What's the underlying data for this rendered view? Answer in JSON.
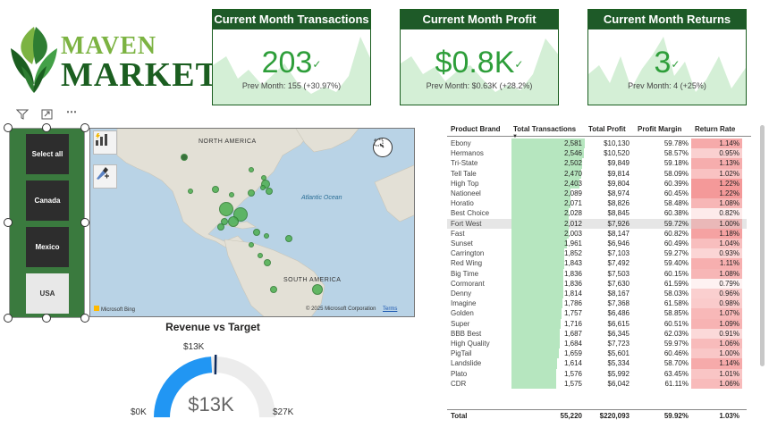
{
  "brand": {
    "word1": "MAVEN",
    "word2": "MARKET"
  },
  "kpis": [
    {
      "title": "Current Month Transactions",
      "value": "203",
      "prev": "Prev Month: 155 (+30.97%)"
    },
    {
      "title": "Current Month Profit",
      "value": "$0.8K",
      "prev": "Prev Month: $0.63K (+28.2%)"
    },
    {
      "title": "Current Month Returns",
      "value": "3",
      "prev": "Prev Month: 4 (+25%)"
    }
  ],
  "slicer": {
    "options": [
      {
        "label": "Select all",
        "selected": true
      },
      {
        "label": "Canada",
        "selected": true
      },
      {
        "label": "Mexico",
        "selected": true
      },
      {
        "label": "USA",
        "selected": false
      }
    ],
    "icons": [
      "filter-icon",
      "focus-mode-icon",
      "more-options-icon"
    ]
  },
  "map": {
    "labels": {
      "north_america": "NORTH AMERICA",
      "south_america": "SOUTH AMERICA",
      "ocean": "Atlantic Ocean"
    },
    "credit_left": "Microsoft Bing",
    "credit_right": "© 2025 Microsoft Corporation",
    "terms": "Terms",
    "bubble_color": "#4caf50"
  },
  "gauge": {
    "title": "Revenue vs Target",
    "min_label": "$0K",
    "max_label": "$27K",
    "target_label": "$13K",
    "value_label": "$13K",
    "value": 13,
    "min": 0,
    "max": 27,
    "fill_color": "#2196f3",
    "target_color": "#0d2a5c"
  },
  "table": {
    "headers": [
      "Product Brand",
      "Total Transactions",
      "Total Profit",
      "Profit Margin",
      "Return Rate"
    ],
    "max_tx": 2581,
    "rows": [
      [
        "Ebony",
        "2,581",
        "$10,130",
        "59.78%",
        "1.14%"
      ],
      [
        "Hermanos",
        "2,546",
        "$10,520",
        "58.57%",
        "0.95%"
      ],
      [
        "Tri-State",
        "2,502",
        "$9,849",
        "59.18%",
        "1.13%"
      ],
      [
        "Tell Tale",
        "2,470",
        "$9,814",
        "58.09%",
        "1.02%"
      ],
      [
        "High Top",
        "2,403",
        "$9,804",
        "60.39%",
        "1.22%"
      ],
      [
        "Nationeel",
        "2,089",
        "$8,974",
        "60.45%",
        "1.22%"
      ],
      [
        "Horatio",
        "2,071",
        "$8,826",
        "58.48%",
        "1.08%"
      ],
      [
        "Best Choice",
        "2,028",
        "$8,845",
        "60.38%",
        "0.82%"
      ],
      [
        "Fort West",
        "2,012",
        "$7,926",
        "59.72%",
        "1.00%"
      ],
      [
        "Fast",
        "2,003",
        "$8,147",
        "60.82%",
        "1.18%"
      ],
      [
        "Sunset",
        "1,961",
        "$6,946",
        "60.49%",
        "1.04%"
      ],
      [
        "Carrington",
        "1,852",
        "$7,103",
        "59.27%",
        "0.93%"
      ],
      [
        "Red Wing",
        "1,843",
        "$7,492",
        "59.40%",
        "1.11%"
      ],
      [
        "Big Time",
        "1,836",
        "$7,503",
        "60.15%",
        "1.08%"
      ],
      [
        "Cormorant",
        "1,836",
        "$7,630",
        "61.59%",
        "0.79%"
      ],
      [
        "Denny",
        "1,814",
        "$8,167",
        "58.03%",
        "0.96%"
      ],
      [
        "Imagine",
        "1,786",
        "$7,368",
        "61.58%",
        "0.98%"
      ],
      [
        "Golden",
        "1,757",
        "$6,486",
        "58.85%",
        "1.07%"
      ],
      [
        "Super",
        "1,716",
        "$6,615",
        "60.51%",
        "1.09%"
      ],
      [
        "BBB Best",
        "1,687",
        "$6,345",
        "62.03%",
        "0.91%"
      ],
      [
        "High Quality",
        "1,684",
        "$7,723",
        "59.97%",
        "1.06%"
      ],
      [
        "PigTail",
        "1,659",
        "$5,601",
        "60.46%",
        "1.00%"
      ],
      [
        "Landslide",
        "1,614",
        "$5,334",
        "58.70%",
        "1.14%"
      ],
      [
        "Plato",
        "1,576",
        "$5,992",
        "63.45%",
        "1.01%"
      ],
      [
        "CDR",
        "1,575",
        "$6,042",
        "61.11%",
        "1.06%"
      ]
    ],
    "highlighted_row": "Fort West",
    "total": [
      "Total",
      "55,220",
      "$220,093",
      "59.92%",
      "1.03%"
    ]
  },
  "colors": {
    "kpi_header": "#1e5a28",
    "kpi_value": "#2e9e3a",
    "tx_bar": "#b6e6bf",
    "return_high": "#f08c8c"
  }
}
